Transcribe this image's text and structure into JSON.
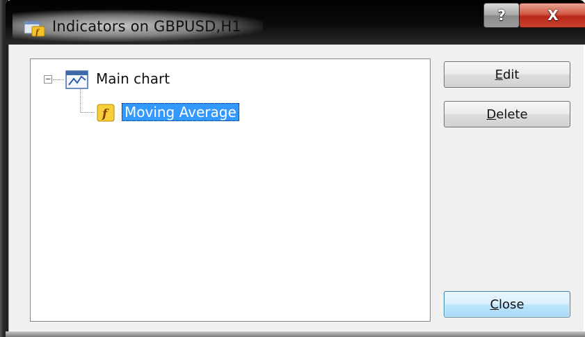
{
  "window": {
    "title": "Indicators on GBPUSD,H1",
    "app_icon": "indicator-window-icon",
    "help_label": "?",
    "close_label": "X"
  },
  "tree": {
    "expander_label": "−",
    "root": {
      "label": "Main chart",
      "icon": "chart-window-icon",
      "expanded": true
    },
    "children": [
      {
        "label": "Moving Average",
        "icon": "function-icon",
        "selected": true
      }
    ]
  },
  "buttons": {
    "edit": {
      "mnemonic": "E",
      "rest": "dit"
    },
    "delete": {
      "mnemonic": "D",
      "rest": "elete"
    },
    "close": {
      "mnemonic": "C",
      "rest": "lose"
    }
  },
  "colors": {
    "selection": "#3399ff",
    "close_button": "#c8422e"
  }
}
